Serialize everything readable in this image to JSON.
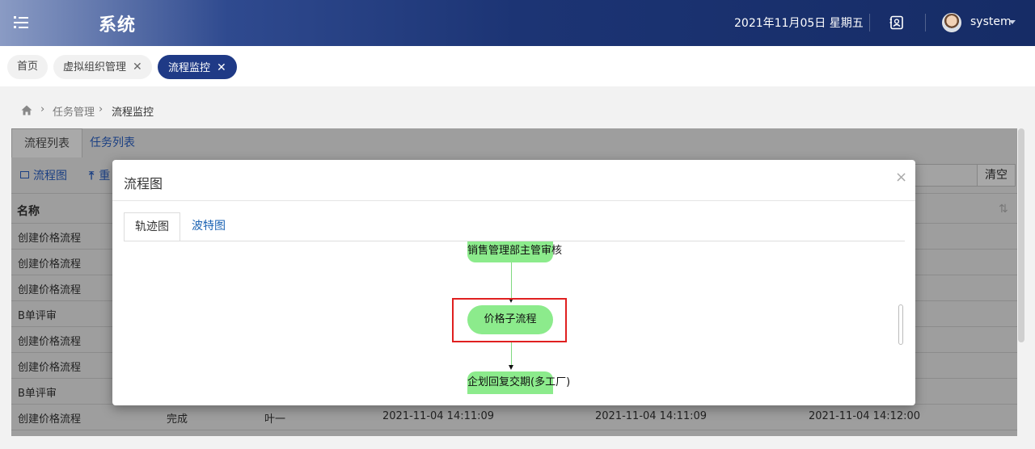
{
  "header": {
    "app_title": "系统",
    "date": "2021年11月05日 星期五",
    "user": "system",
    "colors": {
      "bar_start": "#8a9bc4",
      "bar_end": "#162c66"
    }
  },
  "nav_tabs": [
    {
      "label": "首页",
      "closable": false,
      "active": false
    },
    {
      "label": "虚拟组织管理",
      "closable": true,
      "active": false
    },
    {
      "label": "流程监控",
      "closable": true,
      "active": true
    }
  ],
  "breadcrumb": {
    "items": [
      "任务管理",
      "流程监控"
    ]
  },
  "panel": {
    "tabs": [
      "流程列表",
      "任务列表"
    ],
    "toolbar": {
      "flowchart_label": "流程图",
      "second_label": "重",
      "clear_label": "清空"
    },
    "column_name": "名称",
    "rows": [
      {
        "name": "创建价格流程"
      },
      {
        "name": "创建价格流程"
      },
      {
        "name": "创建价格流程"
      },
      {
        "name": "B单评审"
      },
      {
        "name": "创建价格流程"
      },
      {
        "name": "创建价格流程"
      },
      {
        "name": "B单评审"
      },
      {
        "name": "创建价格流程",
        "status": "完成",
        "person": "叶一",
        "start": "2021-11-04 14:11:09",
        "time2": "2021-11-04 14:11:09",
        "end": "2021-11-04 14:12:00"
      }
    ]
  },
  "modal": {
    "title": "流程图",
    "close": "×",
    "tabs": [
      "轨迹图",
      "波特图"
    ],
    "nodes": {
      "top": "销售管理部主管审核",
      "current": "价格子流程",
      "bottom": "企划回复交期(多工厂)"
    },
    "colors": {
      "node": "#8ceb8c",
      "highlight": "#e02020"
    }
  }
}
